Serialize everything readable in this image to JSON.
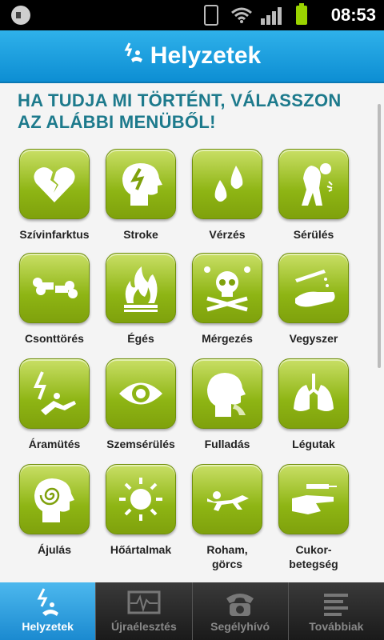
{
  "status_bar": {
    "time": "08:53"
  },
  "title_bar": {
    "title": "Helyzetek",
    "icon": "electric-person-icon"
  },
  "heading": "HA TUDJA MI TÖRTÉNT, VÁLASSZON AZ ALÁBBI MENÜBŐL!",
  "tiles": [
    {
      "label": "Szívinfarktus",
      "icon": "broken-heart-icon"
    },
    {
      "label": "Stroke",
      "icon": "head-bolt-icon"
    },
    {
      "label": "Vérzés",
      "icon": "drops-icon"
    },
    {
      "label": "Sérülés",
      "icon": "injured-person-icon"
    },
    {
      "label": "Csonttörés",
      "icon": "broken-bone-icon"
    },
    {
      "label": "Égés",
      "icon": "flame-icon"
    },
    {
      "label": "Mérgezés",
      "icon": "skull-icon"
    },
    {
      "label": "Vegyszer",
      "icon": "chemical-hand-icon"
    },
    {
      "label": "Áramütés",
      "icon": "electrocution-icon"
    },
    {
      "label": "Szemsérülés",
      "icon": "eye-icon"
    },
    {
      "label": "Fulladás",
      "icon": "choking-icon"
    },
    {
      "label": "Légutak",
      "icon": "lungs-icon"
    },
    {
      "label": "Ájulás",
      "icon": "spiral-head-icon"
    },
    {
      "label": "Hőártalmak",
      "icon": "sun-icon"
    },
    {
      "label": "Roham,\ngörcs",
      "icon": "seizure-icon"
    },
    {
      "label": "Cukor-\nbetegség",
      "icon": "syringe-hand-icon"
    }
  ],
  "tabs": [
    {
      "label": "Helyzetek",
      "icon": "electric-person-icon",
      "active": true
    },
    {
      "label": "Újraélesztés",
      "icon": "ecg-monitor-icon",
      "active": false
    },
    {
      "label": "Segélyhívó",
      "icon": "telephone-icon",
      "active": false
    },
    {
      "label": "Továbbiak",
      "icon": "list-icon",
      "active": false
    }
  ],
  "colors": {
    "accent_blue": "#1b8ad0",
    "tile_green": "#8eb514",
    "heading": "#1d7a8c"
  }
}
